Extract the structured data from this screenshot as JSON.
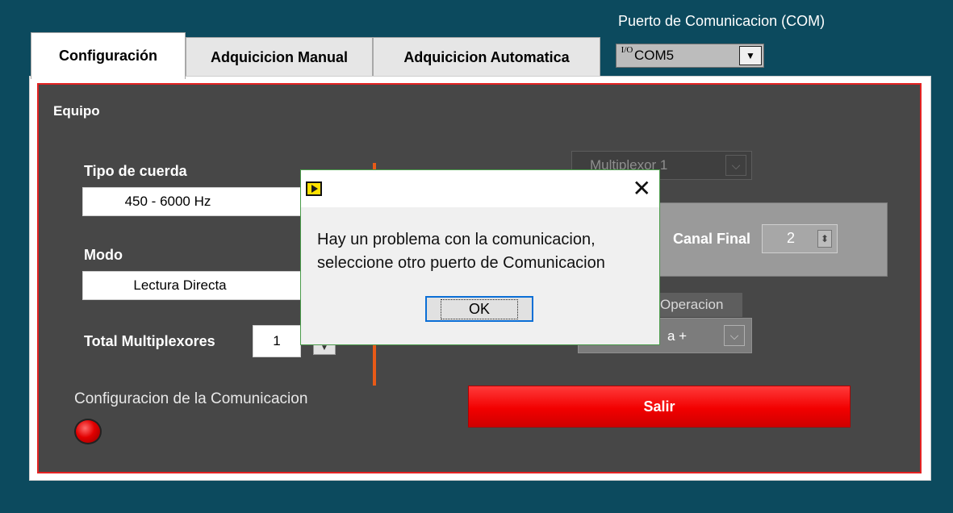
{
  "com": {
    "label": "Puerto de Comunicacion (COM)",
    "io_glyph": "I/O",
    "value": "COM5",
    "dropdown_glyph": "▼"
  },
  "tabs": [
    {
      "label": "Configuración",
      "active": true
    },
    {
      "label": "Adquicicion Manual",
      "active": false
    },
    {
      "label": "Adquicicion Automatica",
      "active": false
    }
  ],
  "panel": {
    "heading": "Equipo",
    "tipo_cuerda": {
      "label": "Tipo de cuerda",
      "value": "450 - 6000 Hz"
    },
    "modo": {
      "label": "Modo",
      "value": "Lectura Directa"
    },
    "total_multiplexores": {
      "label": "Total Multiplexores",
      "value": "1",
      "spinner_glyph": "▼"
    },
    "multiplexor_ring": {
      "value": "Multiplexor 1",
      "dropdown_glyph": "⌵"
    },
    "canal_final": {
      "label": "Canal Final",
      "value": "2",
      "spinner_glyph": "⬍"
    },
    "operacion": {
      "label": "Operacion",
      "value": "a +",
      "dropdown_glyph": "⌵"
    },
    "salir_label": "Salir",
    "comm_indicator_label": "Configuracion de la Comunicacion"
  },
  "dialog": {
    "close_glyph": "✕",
    "message": "Hay un problema con la comunicacion,\nseleccione otro puerto de Comunicacion",
    "ok_label": "OK"
  },
  "colors": {
    "background": "#0c4a5e",
    "panel": "#474747",
    "panel_border": "#e32222",
    "salir": "#f20000",
    "led": "#e20000",
    "divider": "#e85a17",
    "dialog_border": "#4a9c4a",
    "ok_focus": "#0b6fd6"
  }
}
